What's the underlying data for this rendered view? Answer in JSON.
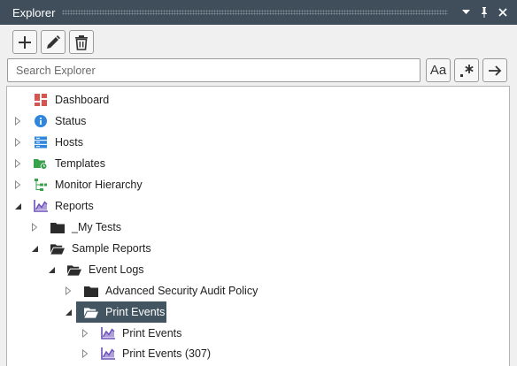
{
  "window": {
    "title": "Explorer"
  },
  "toolbar": {
    "add": "add",
    "edit": "edit",
    "delete": "delete"
  },
  "search": {
    "placeholder": "Search Explorer",
    "value": "",
    "case_label": "Aa"
  },
  "tree": {
    "items": [
      {
        "label": "Dashboard",
        "icon": "dashboard-icon",
        "level": 0,
        "expander": "none"
      },
      {
        "label": "Status",
        "icon": "info-icon",
        "level": 0,
        "expander": "collapsed"
      },
      {
        "label": "Hosts",
        "icon": "hosts-icon",
        "level": 0,
        "expander": "collapsed"
      },
      {
        "label": "Templates",
        "icon": "templates-icon",
        "level": 0,
        "expander": "collapsed"
      },
      {
        "label": "Monitor Hierarchy",
        "icon": "hierarchy-icon",
        "level": 0,
        "expander": "collapsed"
      },
      {
        "label": "Reports",
        "icon": "reports-icon",
        "level": 0,
        "expander": "expanded"
      },
      {
        "label": "_My Tests",
        "icon": "folder-icon",
        "level": 1,
        "expander": "collapsed"
      },
      {
        "label": "Sample Reports",
        "icon": "folder-open-icon",
        "level": 1,
        "expander": "expanded"
      },
      {
        "label": "Event Logs",
        "icon": "folder-open-icon",
        "level": 2,
        "expander": "expanded"
      },
      {
        "label": "Advanced Security Audit Policy",
        "icon": "folder-icon",
        "level": 3,
        "expander": "collapsed"
      },
      {
        "label": "Print Events",
        "icon": "folder-open-icon",
        "level": 3,
        "expander": "expanded",
        "selected": true
      },
      {
        "label": "Print Events",
        "icon": "report-icon",
        "level": 4,
        "expander": "collapsed"
      },
      {
        "label": "Print Events (307)",
        "icon": "report-icon",
        "level": 4,
        "expander": "collapsed"
      }
    ]
  },
  "colors": {
    "titlebar": "#3f4e5a",
    "selection": "#435561",
    "dashboard": "#d9534f",
    "info": "#2e86de",
    "templates": "#3aa14b",
    "reports": "#6b4fbb"
  }
}
